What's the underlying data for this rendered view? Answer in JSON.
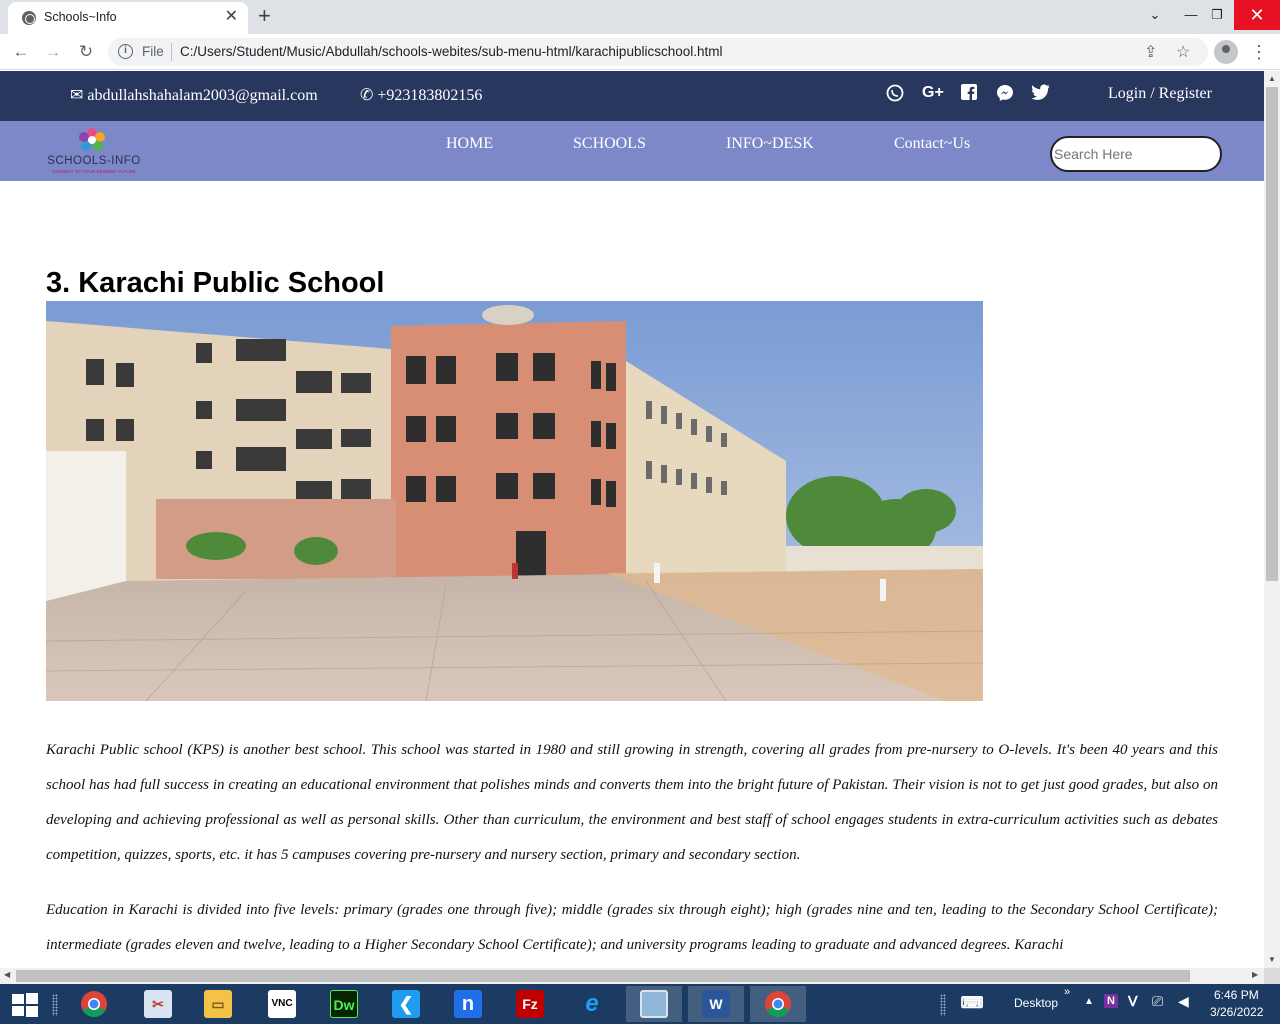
{
  "browser": {
    "tab_title": "Schools~Info",
    "url_scheme_label": "File",
    "url": "C:/Users/Student/Music/Abdullah/schools-webites/sub-menu-html/karachipublicschool.html"
  },
  "site": {
    "topbar": {
      "email": "abdullahshahalam2003@gmail.com",
      "phone": "+923183802156",
      "social_icons": [
        "viber-icon",
        "google-plus-icon",
        "facebook-icon",
        "messenger-icon",
        "twitter-icon"
      ],
      "login_label": "Login / Register"
    },
    "logo": {
      "name": "SCHOOLS-INFO",
      "tagline": "GATEWAY TO YOUR DESIRED FUTURE"
    },
    "nav": [
      "HOME",
      "SCHOOLS",
      "INFO~DESK",
      "Contact~Us"
    ],
    "search_placeholder": "Search Here",
    "colors": {
      "topbar_bg": "#27375e",
      "navbar_bg": "#7d88c9"
    }
  },
  "content": {
    "heading": "3. Karachi Public School",
    "paragraphs": [
      "Karachi Public school (KPS) is another best school. This school was started in 1980 and still growing in strength, covering all grades from pre-nursery to O-levels. It's been 40 years and this school has had full success in creating an educational environment that polishes minds and converts them into the bright future of Pakistan. Their vision is not to get just good grades, but also on developing and achieving professional as well as personal skills. Other than curriculum, the environment and best staff of school engages students in extra-curriculum activities such as debates competition, quizzes, sports, etc. it has 5 campuses covering pre-nursery and nursery section, primary and secondary section.",
      "Education in Karachi is divided into five levels: primary (grades one through five); middle (grades six through eight); high (grades nine and ten, leading to the Secondary School Certificate); intermediate (grades eleven and twelve, leading to a Higher Secondary School Certificate); and university programs leading to graduate and advanced degrees. Karachi"
    ]
  },
  "taskbar": {
    "apps": [
      "chrome-icon",
      "snipping-tool-icon",
      "file-explorer-icon",
      "vnc-viewer-icon",
      "dreamweaver-icon",
      "vscode-icon",
      "nox-icon",
      "filezilla-icon",
      "internet-explorer-icon",
      "photo-viewer-icon",
      "word-icon",
      "chrome-active-icon"
    ],
    "desktop_label": "Desktop",
    "time": "6:46 PM",
    "date": "3/26/2022"
  }
}
